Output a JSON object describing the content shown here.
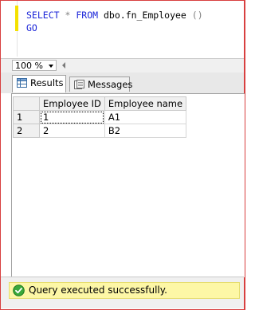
{
  "editor": {
    "line1": {
      "kw_select": "SELECT",
      "star": "*",
      "kw_from": "FROM",
      "object": "dbo.fn_Employee",
      "parens": "()"
    },
    "line2": {
      "kw_go": "GO"
    }
  },
  "zoom": {
    "value": "100 %"
  },
  "tabs": [
    {
      "label": "Results",
      "icon": "grid-icon",
      "active": true
    },
    {
      "label": "Messages",
      "icon": "messages-icon",
      "active": false
    }
  ],
  "results": {
    "columns": [
      "Employee ID",
      "Employee name"
    ],
    "rows": [
      {
        "num": "1",
        "cells": [
          "1",
          "A1"
        ]
      },
      {
        "num": "2",
        "cells": [
          "2",
          "B2"
        ]
      }
    ]
  },
  "status": {
    "text": "Query executed successfully.",
    "icon": "success-check-icon",
    "background": "#fdf7a6"
  },
  "colors": {
    "keyword": "#1c26d8",
    "frame": "#d84040",
    "change_bar": "#f4e100"
  }
}
